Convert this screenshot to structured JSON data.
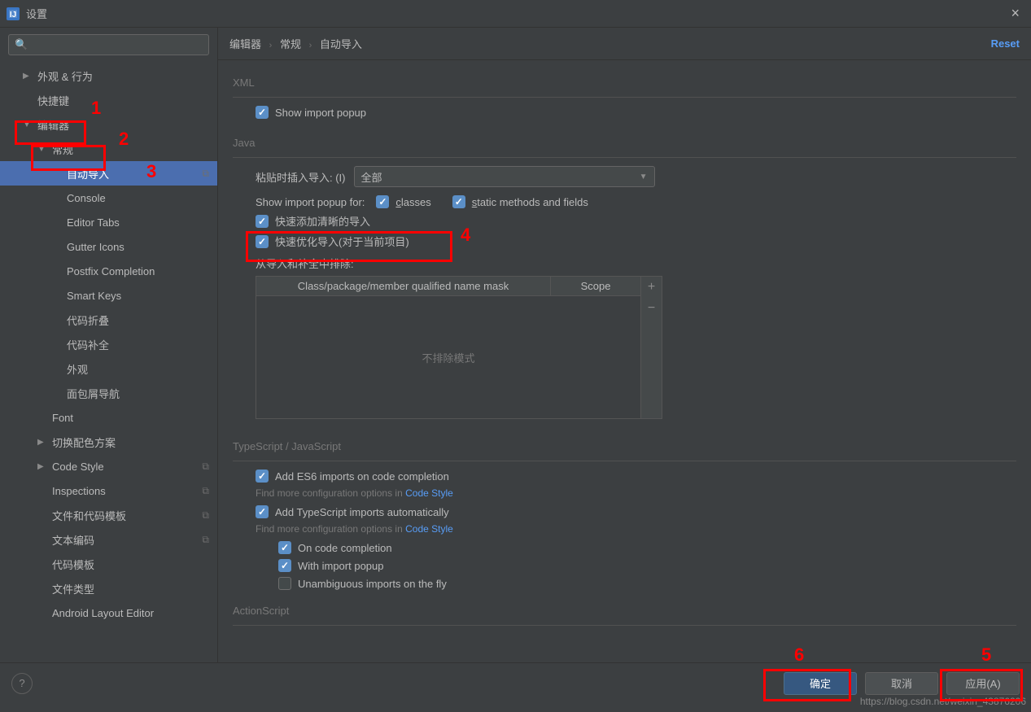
{
  "window": {
    "title": "设置"
  },
  "header": {
    "breadcrumb": [
      "编辑器",
      "常规",
      "自动导入"
    ],
    "reset": "Reset"
  },
  "sidebar": {
    "search_placeholder": "",
    "items": [
      {
        "label": "外观 & 行为",
        "arrow": "closed",
        "indent": 1
      },
      {
        "label": "快捷键",
        "arrow": "none",
        "indent": 1
      },
      {
        "label": "编辑器",
        "arrow": "open",
        "indent": 1
      },
      {
        "label": "常规",
        "arrow": "open",
        "indent": 2
      },
      {
        "label": "自动导入",
        "arrow": "none",
        "indent": 3,
        "selected": true,
        "badge": "⧉"
      },
      {
        "label": "Console",
        "arrow": "none",
        "indent": 3
      },
      {
        "label": "Editor Tabs",
        "arrow": "none",
        "indent": 3
      },
      {
        "label": "Gutter Icons",
        "arrow": "none",
        "indent": 3
      },
      {
        "label": "Postfix Completion",
        "arrow": "none",
        "indent": 3
      },
      {
        "label": "Smart Keys",
        "arrow": "none",
        "indent": 3
      },
      {
        "label": "代码折叠",
        "arrow": "none",
        "indent": 3
      },
      {
        "label": "代码补全",
        "arrow": "none",
        "indent": 3
      },
      {
        "label": "外观",
        "arrow": "none",
        "indent": 3
      },
      {
        "label": "面包屑导航",
        "arrow": "none",
        "indent": 3
      },
      {
        "label": "Font",
        "arrow": "none",
        "indent": 2
      },
      {
        "label": "切换配色方案",
        "arrow": "closed",
        "indent": 2
      },
      {
        "label": "Code Style",
        "arrow": "closed",
        "indent": 2,
        "badge": "⧉"
      },
      {
        "label": "Inspections",
        "arrow": "none",
        "indent": 2,
        "badge": "⧉"
      },
      {
        "label": "文件和代码模板",
        "arrow": "none",
        "indent": 2,
        "badge": "⧉"
      },
      {
        "label": "文本编码",
        "arrow": "none",
        "indent": 2,
        "badge": "⧉"
      },
      {
        "label": "代码模板",
        "arrow": "none",
        "indent": 2
      },
      {
        "label": "文件类型",
        "arrow": "none",
        "indent": 2
      },
      {
        "label": "Android Layout Editor",
        "arrow": "none",
        "indent": 2
      }
    ]
  },
  "sections": {
    "xml": {
      "title": "XML",
      "show_import_popup": "Show import popup"
    },
    "java": {
      "title": "Java",
      "paste_label": "粘贴时插入导入:   (I)",
      "paste_value": "全部",
      "popup_for_label": "Show import popup for:",
      "classes": "classes",
      "static": "static methods and fields",
      "add_clear": "快速添加清晰的导入",
      "optimize": "快速优化导入(对于当前项目)",
      "exclude_title": "从导入和补全中排除:",
      "table_col1": "Class/package/member qualified name mask",
      "table_col2": "Scope",
      "table_empty": "不排除模式"
    },
    "ts": {
      "title": "TypeScript / JavaScript",
      "es6": "Add ES6 imports on code completion",
      "hint1_pre": "Find more configuration options in ",
      "hint1_link": "Code Style",
      "ts_auto": "Add TypeScript imports automatically",
      "hint2_pre": "Find more configuration options in ",
      "hint2_link": "Code Style",
      "on_complete": "On code completion",
      "with_popup": "With import popup",
      "unambiguous": "Unambiguous imports on the fly"
    },
    "as": {
      "title": "ActionScript"
    }
  },
  "footer": {
    "ok": "确定",
    "cancel": "取消",
    "apply": "应用(A)"
  },
  "watermark": "https://blog.csdn.net/weixin_43876206",
  "annotations": {
    "n1": "1",
    "n2": "2",
    "n3": "3",
    "n4": "4",
    "n5": "5",
    "n6": "6"
  }
}
